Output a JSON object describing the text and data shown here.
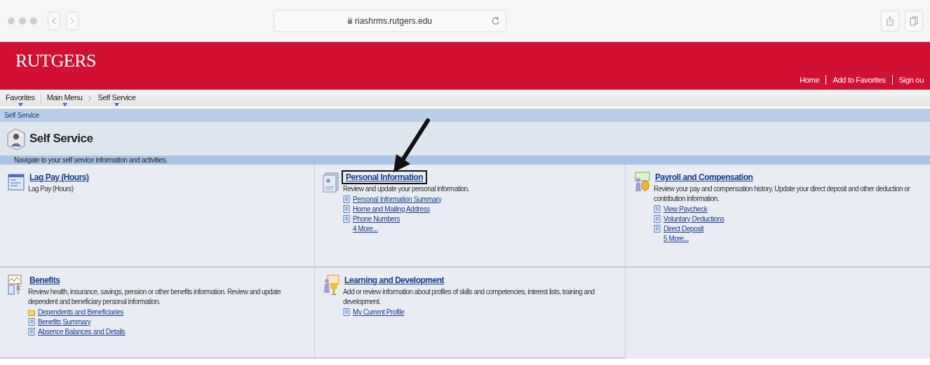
{
  "browser": {
    "url": "riashrms.rutgers.edu"
  },
  "header": {
    "logo": "RUTGERS",
    "links": [
      "Home",
      "Add to Favorites",
      "Sign ou"
    ]
  },
  "nav": {
    "favorites": "Favorites",
    "path": [
      "Main Menu",
      "Self Service"
    ]
  },
  "breadcrumb": "Self Service",
  "page": {
    "title": "Self Service",
    "description": "Navigate to your self service information and activities."
  },
  "tiles": [
    {
      "title": "Lag Pay (Hours)",
      "highlighted": false,
      "description": "Lag Pay (Hours)"
    },
    {
      "title": "Personal Information",
      "highlighted": true,
      "description": "Review and update your personal information.",
      "links": [
        {
          "label": "Personal Information Summary",
          "kind": "page"
        },
        {
          "label": "Home and Mailing Address",
          "kind": "page"
        },
        {
          "label": "Phone Numbers",
          "kind": "page"
        },
        {
          "label": "4 More...",
          "kind": "more"
        }
      ]
    },
    {
      "title": "Payroll and Compensation",
      "highlighted": false,
      "description": "Review your pay and compensation history. Update your direct deposit and other deduction or contribution information.",
      "links": [
        {
          "label": "View Paycheck",
          "kind": "page"
        },
        {
          "label": "Voluntary Deductions",
          "kind": "page"
        },
        {
          "label": "Direct Deposit",
          "kind": "page"
        },
        {
          "label": "5 More...",
          "kind": "more"
        }
      ]
    },
    {
      "title": "Benefits",
      "highlighted": false,
      "description": "Review health, insurance, savings, pension or other benefits information. Review and update dependent and beneficiary personal information.",
      "links": [
        {
          "label": "Dependents and Beneficiaries",
          "kind": "folder"
        },
        {
          "label": "Benefits Summary",
          "kind": "page"
        },
        {
          "label": "Absence Balances and Details",
          "kind": "page"
        }
      ]
    },
    {
      "title": "Learning and Development",
      "highlighted": false,
      "description": "Add or review information about profiles of skills and competencies, interest lists, training and development.",
      "links": [
        {
          "label": "My Current Profile",
          "kind": "page"
        }
      ]
    }
  ]
}
